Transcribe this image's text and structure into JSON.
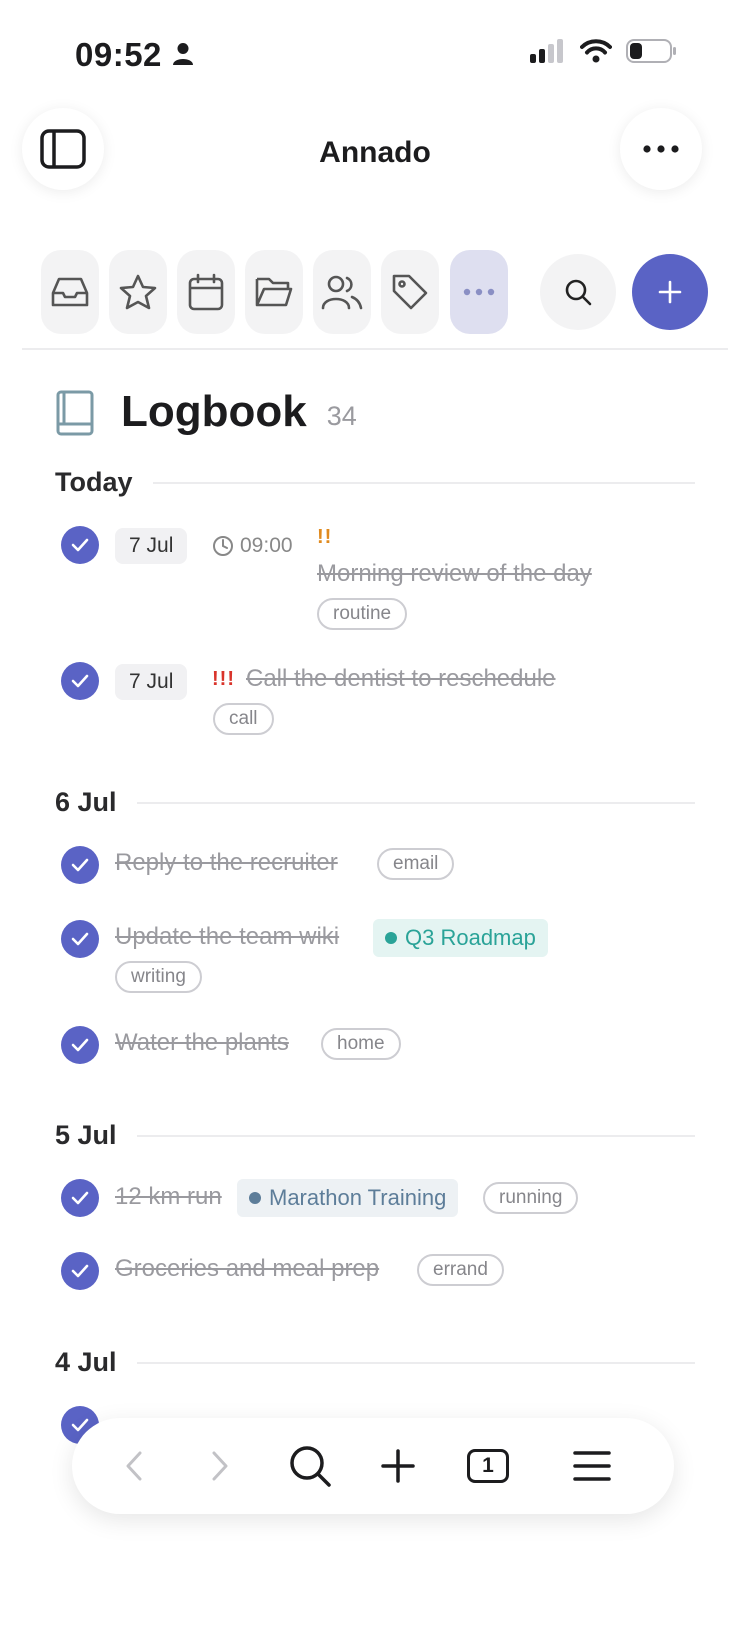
{
  "status_bar": {
    "time": "09:52"
  },
  "nav": {
    "title": "Annado"
  },
  "logbook": {
    "title": "Logbook",
    "count": "34"
  },
  "sections": {
    "today": "Today",
    "jul6": "6 Jul",
    "jul5": "5 Jul",
    "jul4": "4 Jul"
  },
  "tasks": {
    "t1": {
      "date": "7 Jul",
      "time": "09:00",
      "priority": "!!",
      "title": "Morning review of the day",
      "tag": "routine"
    },
    "t2": {
      "date": "7 Jul",
      "priority": "!!!",
      "title": "Call the dentist to reschedule",
      "tag": "call"
    },
    "t3": {
      "title": "Reply to the recruiter",
      "tag": "email"
    },
    "t4": {
      "title": "Update the team wiki",
      "project": "Q3 Roadmap",
      "tag": "writing"
    },
    "t5": {
      "title": "Water the plants",
      "tag": "home"
    },
    "t6": {
      "title": "12 km run",
      "project": "Marathon Training",
      "tag": "running"
    },
    "t7": {
      "title": "Groceries and meal prep",
      "tag": "errand"
    }
  },
  "bottom_bar": {
    "tabs_count": "1"
  },
  "colors": {
    "accent": "#5a63c5",
    "priority_high": "#e08a1e",
    "priority_urgent": "#d9342b",
    "project_q3": "#2aa398",
    "project_marathon": "#5d7d99"
  },
  "icons": [
    "sidebar-icon",
    "more-icon",
    "inbox-icon",
    "star-icon",
    "calendar-icon",
    "folder-icon",
    "people-icon",
    "tag-icon",
    "search-icon",
    "plus-icon",
    "book-icon",
    "clock-icon",
    "check-icon",
    "back-icon",
    "forward-icon",
    "tabs-icon",
    "menu-icon"
  ]
}
